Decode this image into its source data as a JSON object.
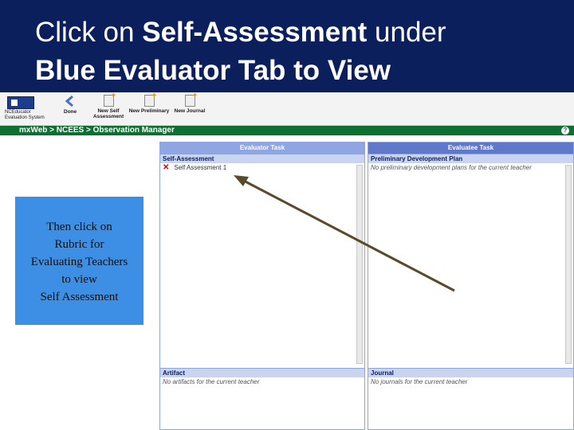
{
  "slide": {
    "title_line1_prefix": "Click on ",
    "title_line1_bold": "Self-Assessment",
    "title_line1_suffix": " under",
    "title_line2_bold": "Blue Evaluator Tab to View",
    "title_bg_color": "#0b1f5c"
  },
  "toolbar": {
    "logo_text": "NCEducator Evaluation System",
    "buttons": [
      {
        "label": "Done",
        "icon": "back-arrow-icon"
      },
      {
        "label": "New Self Assessment",
        "icon": "new-document-icon"
      },
      {
        "label": "New Preliminary",
        "icon": "new-document-icon"
      },
      {
        "label": "New Journal",
        "icon": "new-document-icon"
      }
    ]
  },
  "breadcrumb": {
    "text": "mxWeb  >  NCEES  >  Observation Manager",
    "color": "#0f6f33"
  },
  "panels": {
    "left_tab": "Evaluator Task",
    "right_tab": "Evaluatee Task",
    "self_assessment": {
      "header": "Self-Assessment",
      "item": "Self Assessment 1"
    },
    "preliminary": {
      "header": "Preliminary Development Plan",
      "empty_text": "No preliminary development plans for the current teacher"
    },
    "artifact": {
      "header": "Artifact",
      "empty_text": "No artifacts for the current teacher"
    },
    "journal": {
      "header": "Journal",
      "empty_text": "No journals for the current teacher"
    }
  },
  "callout": {
    "text_line1": "Then click on",
    "text_line2": "Rubric for",
    "text_line3": "Evaluating Teachers",
    "text_line4": "to view",
    "text_line5": "Self Assessment",
    "color": "#3d8fe6"
  },
  "annotation_arrow_color": "#5a4a2a"
}
